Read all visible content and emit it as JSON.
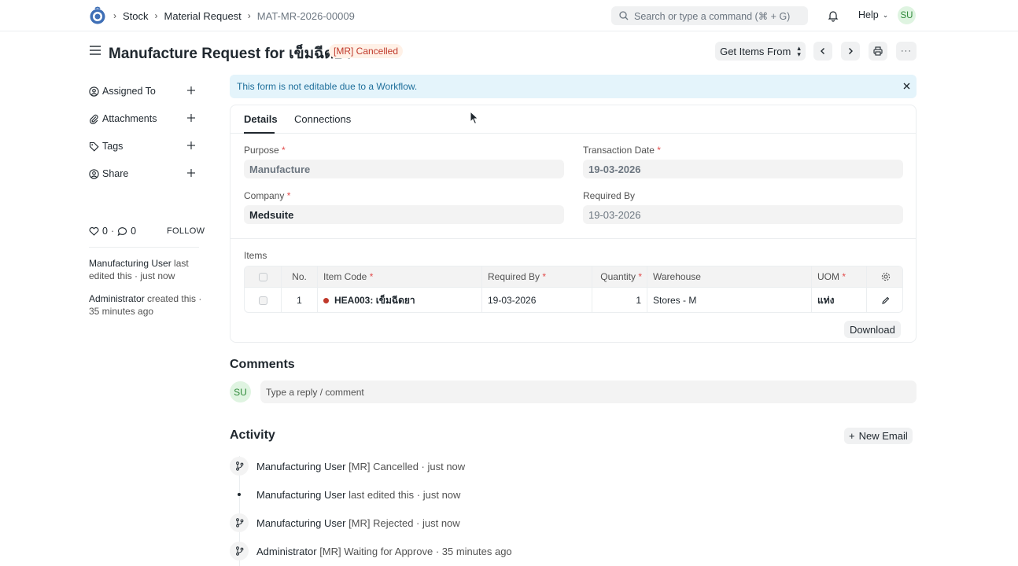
{
  "navbar": {
    "breadcrumbs": [
      "Stock",
      "Material Request",
      "MAT-MR-2026-00009"
    ],
    "search_placeholder": "Search or type a command (⌘ + G)",
    "help_label": "Help",
    "user_initials": "SU"
  },
  "header": {
    "title": "Manufacture Request for เข็มฉีดยา",
    "status": "[MR] Cancelled",
    "get_items_label": "Get Items From"
  },
  "sidebar": {
    "items": [
      {
        "label": "Assigned To",
        "icon": "user-circle-icon"
      },
      {
        "label": "Attachments",
        "icon": "paperclip-icon"
      },
      {
        "label": "Tags",
        "icon": "tag-icon"
      },
      {
        "label": "Share",
        "icon": "share-icon"
      }
    ],
    "likes": "0",
    "comments": "0",
    "follow_label": "FOLLOW",
    "activity": [
      {
        "user": "Manufacturing User",
        "text": " last edited this · just now"
      },
      {
        "user": "Administrator",
        "text": " created this · 35 minutes ago"
      }
    ]
  },
  "alert": "This form is not editable due to a Workflow.",
  "tabs": [
    "Details",
    "Connections"
  ],
  "form": {
    "purpose_label": "Purpose",
    "purpose_value": "Manufacture",
    "transaction_date_label": "Transaction Date",
    "transaction_date_value": "19-03-2026",
    "company_label": "Company",
    "company_value": "Medsuite",
    "required_by_label": "Required By",
    "required_by_value": "19-03-2026"
  },
  "items_table": {
    "label": "Items",
    "columns": [
      "No.",
      "Item Code",
      "Required By",
      "Quantity",
      "Warehouse",
      "UOM"
    ],
    "rows": [
      {
        "no": "1",
        "item_code": "HEA003: เข็มฉีดยา",
        "required_by": "19-03-2026",
        "quantity": "1",
        "warehouse": "Stores - M",
        "uom": "แท่ง"
      }
    ],
    "download_label": "Download"
  },
  "comments": {
    "title": "Comments",
    "avatar": "SU",
    "placeholder": "Type a reply / comment"
  },
  "activity": {
    "title": "Activity",
    "new_email_label": "New Email",
    "entries": [
      {
        "user": "Manufacturing User",
        "text": " [MR] Cancelled · just now",
        "icon": "branch-icon"
      },
      {
        "user": "Manufacturing User",
        "text": " last edited this · just now",
        "icon": "dot"
      },
      {
        "user": "Manufacturing User",
        "text": " [MR] Rejected · just now",
        "icon": "branch-icon"
      },
      {
        "user": "Administrator",
        "text": " [MR] Waiting for Approve · 35 minutes ago",
        "icon": "branch-icon"
      }
    ]
  }
}
